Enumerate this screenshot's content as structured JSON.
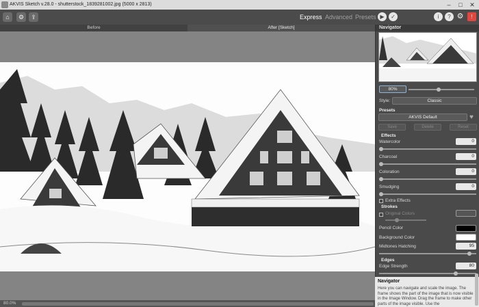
{
  "window": {
    "title": "AKVIS Sketch v.28.0 - shutterstock_1839281002.jpg (5000 x 2813)"
  },
  "toolbar": {
    "modes": [
      "Express",
      "Advanced",
      "Presets"
    ]
  },
  "tabs": {
    "before": "Before",
    "after": "After [Sketch]"
  },
  "status": {
    "zoom": "80.0%"
  },
  "panel": {
    "navigator_title": "Navigator",
    "zoom_value": "80%",
    "style_label": "Style:",
    "style_value": "Classic",
    "presets_label": "Presets",
    "preset_value": "AKVIS Default",
    "save": "Save",
    "delete": "Delete",
    "reset": "Reset",
    "effects_label": "Effects",
    "watercolor_label": "Watercolor",
    "watercolor_value": "0",
    "watercolor": 0,
    "charcoal_label": "Charcoal",
    "charcoal_value": "0",
    "charcoal": 0,
    "coloration_label": "Coloration",
    "coloration_value": "0",
    "coloration": 0,
    "smudging_label": "Smudging",
    "smudging_value": "0",
    "smudging": 0,
    "extra_effects": "Extra Effects",
    "strokes_label": "Strokes",
    "original_colors": "Original Colors",
    "pencil_color_label": "Pencil Color",
    "pencil_color": "#000000",
    "background_color_label": "Background Color",
    "background_color": "#ffffff",
    "midtones_label": "Midtones Hatching",
    "midtones_value": "95",
    "midtones": 95,
    "edges_label": "Edges",
    "edge_strength_label": "Edge Strength",
    "edge_strength_value": "80",
    "edge_strength": 80
  },
  "help": {
    "title": "Navigator",
    "body": "Here you can navigate and scale the image. The frame shows the part of the image that is now visible in the Image Window. Drag the frame to make other parts of the image visible. Use the"
  },
  "colors": {
    "accent_button": "#e2463f",
    "panel_bg": "#4a4a4a",
    "canvas_bg": "#848484"
  }
}
